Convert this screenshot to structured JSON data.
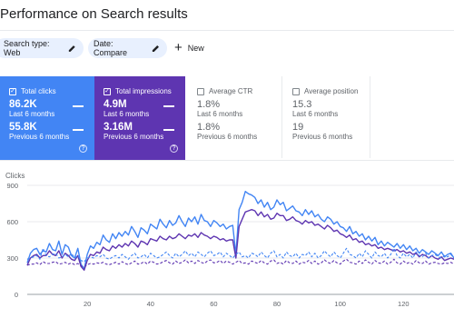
{
  "page_title": "Performance on Search results",
  "filters": {
    "search_type": "Search type: Web",
    "date": "Date: Compare",
    "new_label": "New"
  },
  "metrics": {
    "clicks": {
      "label": "Total clicks",
      "current": "86.2K",
      "current_period": "Last 6 months",
      "previous": "55.8K",
      "previous_period": "Previous 6 months",
      "checked": true,
      "color": "#4285f4"
    },
    "impressions": {
      "label": "Total impressions",
      "current": "4.9M",
      "current_period": "Last 6 months",
      "previous": "3.16M",
      "previous_period": "Previous 6 months",
      "checked": true,
      "color": "#5e35b1"
    },
    "ctr": {
      "label": "Average CTR",
      "current": "1.8%",
      "current_period": "Last 6 months",
      "previous": "1.8%",
      "previous_period": "Previous 6 months",
      "checked": false
    },
    "position": {
      "label": "Average position",
      "current": "15.3",
      "current_period": "Last 6 months",
      "previous": "19",
      "previous_period": "Previous 6 months",
      "checked": false
    }
  },
  "chart_label": "Clicks",
  "chart_data": {
    "type": "line",
    "ylabel": "Clicks",
    "ylim": [
      0,
      900
    ],
    "yticks": [
      0,
      300,
      600,
      900
    ],
    "xlim": [
      1,
      136
    ],
    "xticks": [
      20,
      40,
      60,
      80,
      100,
      120
    ],
    "series": [
      {
        "style": "solid",
        "color": "#4285f4",
        "values": [
          260,
          340,
          370,
          380,
          330,
          360,
          350,
          420,
          370,
          360,
          440,
          330,
          410,
          390,
          320,
          300,
          380,
          250,
          210,
          330,
          400,
          380,
          430,
          410,
          490,
          450,
          430,
          500,
          460,
          510,
          480,
          520,
          490,
          560,
          520,
          470,
          550,
          530,
          500,
          580,
          560,
          540,
          620,
          580,
          550,
          610,
          570,
          590,
          650,
          600,
          560,
          630,
          600,
          640,
          580,
          660,
          610,
          600,
          560,
          610,
          590,
          560,
          580,
          540,
          560,
          570,
          330,
          700,
          760,
          850,
          830,
          820,
          800,
          750,
          780,
          720,
          760,
          700,
          720,
          780,
          740,
          760,
          690,
          710,
          730,
          690,
          680,
          650,
          700,
          660,
          690,
          640,
          660,
          620,
          600,
          640,
          620,
          580,
          600,
          560,
          550,
          520,
          560,
          500,
          520,
          480,
          500,
          450,
          480,
          440,
          470,
          410,
          440,
          400,
          430,
          410,
          390,
          420,
          380,
          410,
          370,
          400,
          360,
          380,
          340,
          370,
          350,
          330,
          360,
          340,
          320,
          350,
          310,
          330,
          340,
          300
        ]
      },
      {
        "style": "solid",
        "color": "#5e35b1",
        "values": [
          240,
          300,
          320,
          330,
          300,
          320,
          320,
          360,
          330,
          320,
          360,
          300,
          340,
          320,
          290,
          280,
          320,
          230,
          200,
          280,
          330,
          320,
          350,
          340,
          390,
          370,
          360,
          400,
          380,
          410,
          390,
          420,
          400,
          440,
          420,
          390,
          440,
          430,
          410,
          460,
          450,
          440,
          480,
          460,
          450,
          480,
          460,
          470,
          500,
          480,
          460,
          490,
          480,
          500,
          470,
          510,
          490,
          480,
          460,
          480,
          470,
          450,
          460,
          440,
          450,
          450,
          300,
          560,
          620,
          680,
          690,
          700,
          690,
          650,
          680,
          640,
          660,
          620,
          630,
          670,
          650,
          650,
          610,
          620,
          640,
          610,
          600,
          580,
          610,
          590,
          600,
          570,
          580,
          560,
          540,
          570,
          550,
          520,
          530,
          500,
          490,
          470,
          490,
          450,
          460,
          430,
          440,
          410,
          420,
          400,
          410,
          380,
          390,
          370,
          380,
          370,
          360,
          370,
          350,
          360,
          340,
          350,
          330,
          340,
          310,
          330,
          320,
          300,
          320,
          300,
          290,
          310,
          280,
          290,
          300,
          290
        ]
      },
      {
        "style": "dashed",
        "color": "#4285f4",
        "values": [
          290,
          300,
          310,
          320,
          290,
          380,
          320,
          310,
          330,
          340,
          300,
          310,
          330,
          310,
          340,
          300,
          320,
          280,
          270,
          300,
          310,
          300,
          320,
          310,
          330,
          300,
          290,
          310,
          320,
          300,
          330,
          310,
          290,
          320,
          340,
          300,
          310,
          330,
          300,
          340,
          320,
          300,
          310,
          330,
          350,
          320,
          300,
          340,
          310,
          330,
          360,
          320,
          340,
          310,
          350,
          330,
          310,
          340,
          360,
          320,
          330,
          350,
          310,
          340,
          320,
          300,
          330,
          350,
          310,
          320,
          300,
          340,
          330,
          310,
          350,
          320,
          300,
          340,
          360,
          310,
          330,
          300,
          350,
          320,
          310,
          340,
          300,
          330,
          320,
          350,
          310,
          340,
          300,
          320,
          360,
          330,
          310,
          350,
          320,
          300,
          340,
          380,
          330,
          320,
          300,
          340,
          310,
          360,
          330,
          300,
          350,
          320,
          310,
          340,
          300,
          330,
          380,
          320,
          300,
          340,
          310,
          330,
          300,
          350,
          320,
          310,
          340,
          300,
          320,
          330,
          310,
          300,
          320,
          310,
          330,
          300
        ]
      },
      {
        "style": "dashed",
        "color": "#5e35b1",
        "values": [
          240,
          250,
          250,
          260,
          245,
          270,
          255,
          255,
          265,
          270,
          250,
          255,
          265,
          250,
          260,
          245,
          255,
          235,
          225,
          245,
          255,
          250,
          260,
          255,
          265,
          250,
          245,
          255,
          265,
          250,
          270,
          255,
          245,
          260,
          275,
          250,
          255,
          270,
          250,
          275,
          265,
          250,
          255,
          270,
          280,
          260,
          250,
          275,
          255,
          265,
          285,
          260,
          275,
          255,
          280,
          265,
          255,
          275,
          285,
          260,
          265,
          280,
          255,
          275,
          265,
          250,
          265,
          280,
          255,
          260,
          250,
          275,
          265,
          255,
          280,
          260,
          250,
          275,
          285,
          255,
          265,
          250,
          280,
          260,
          255,
          275,
          250,
          265,
          260,
          280,
          255,
          275,
          250,
          260,
          285,
          265,
          255,
          280,
          260,
          250,
          275,
          290,
          265,
          260,
          250,
          275,
          255,
          285,
          265,
          250,
          280,
          260,
          255,
          275,
          250,
          265,
          290,
          260,
          250,
          275,
          255,
          265,
          250,
          280,
          260,
          255,
          275,
          250,
          260,
          265,
          255,
          250,
          260,
          255,
          265,
          250
        ]
      }
    ]
  }
}
